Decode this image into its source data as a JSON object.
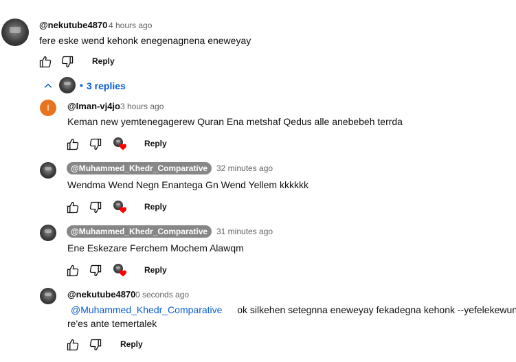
{
  "top_comment": {
    "author": "@nekutube4870",
    "time": "4 hours ago",
    "text": "fere eske wend kehonk enegenagnena eneweyay",
    "reply_label": "Reply"
  },
  "replies_toggle": {
    "label": "3 replies",
    "bullet": "•"
  },
  "replies": [
    {
      "avatar_letter": "I",
      "author": "@Iman-vj4jo",
      "time": "3 hours ago",
      "text": "Keman new yemtenegagerew Quran Ena metshaf Qedus alle anebebeh terrda",
      "reply_label": "Reply"
    },
    {
      "author": "@Muhammed_Khedr_Comparative",
      "time": "32 minutes ago",
      "text": "Wendma Wend Negn Enantega Gn Wend Yellem kkkkkk",
      "reply_label": "Reply"
    },
    {
      "author": "@Muhammed_Khedr_Comparative",
      "time": "31 minutes ago",
      "text": "Ene Eskezare Ferchem Mochem Alawqm",
      "reply_label": "Reply"
    },
    {
      "author": "@nekutube4870",
      "time": "0 seconds ago",
      "mention": "@Muhammed_Khedr_Comparative",
      "text_line1": "ok silkehen setegnna eneweyay fekadegna kehonk --yefelekewun",
      "text_line2": "re'es ante temertalek",
      "reply_label": "Reply"
    }
  ],
  "colors": {
    "link_blue": "#065fd4",
    "secondary_text": "#606060",
    "chip_bg": "#878787",
    "heart_red": "#ff0000"
  }
}
